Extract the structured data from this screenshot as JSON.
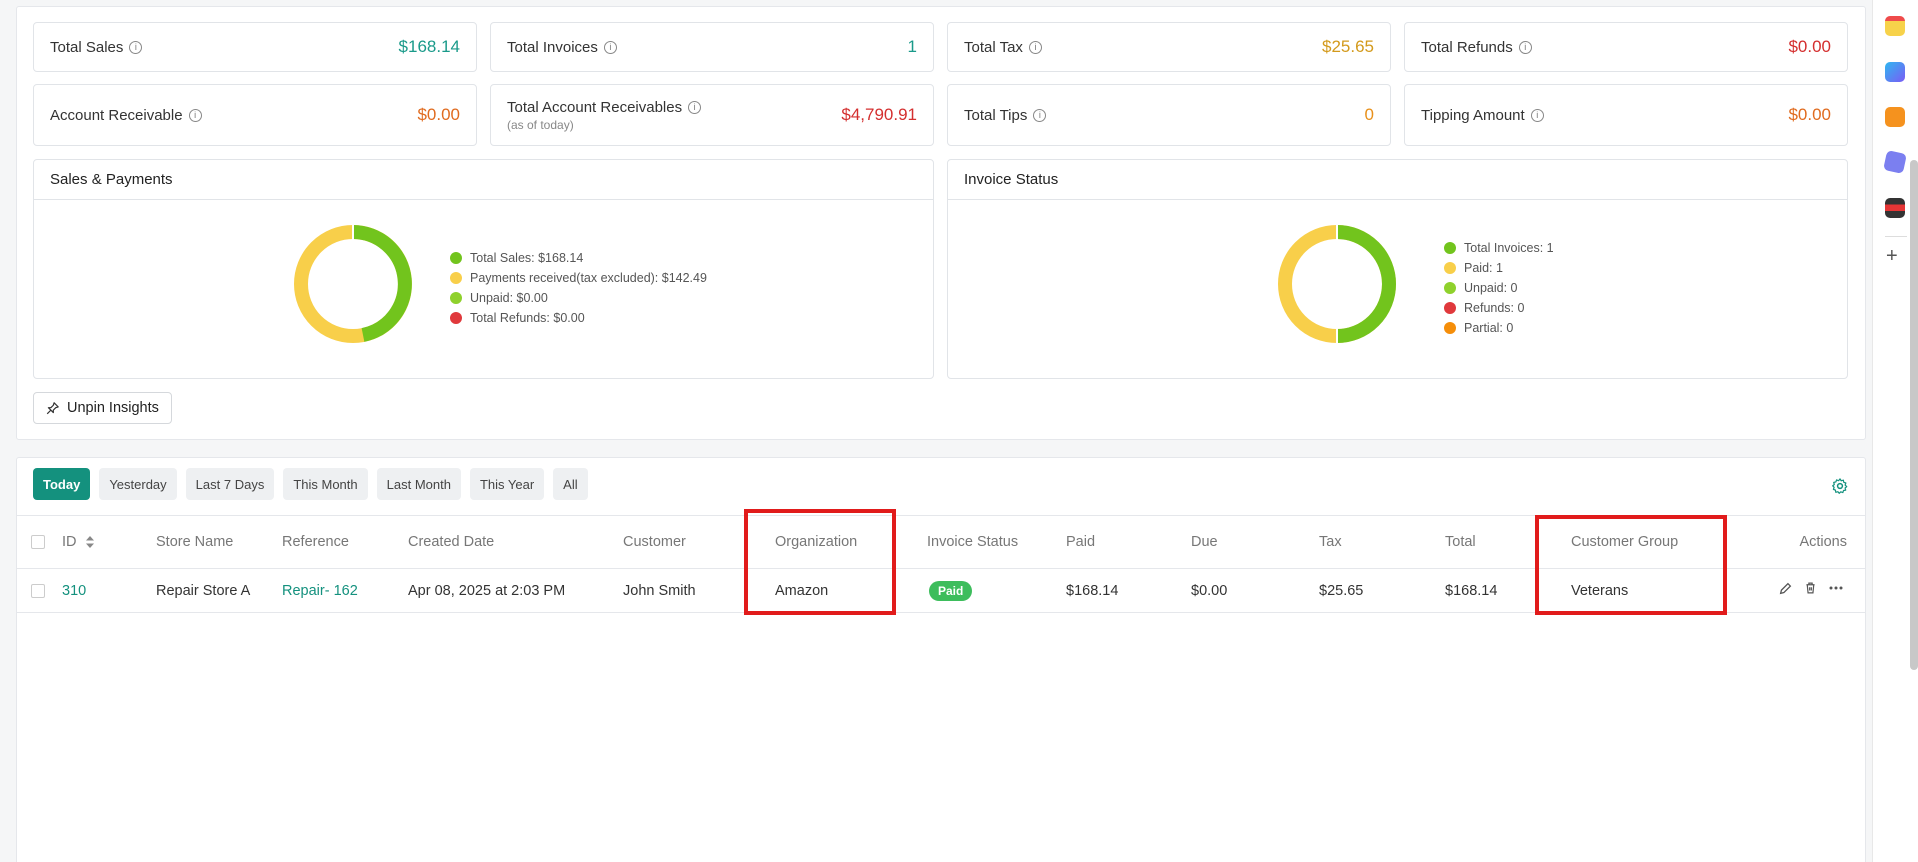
{
  "stats": [
    {
      "label": "Total Sales",
      "value": "$168.14",
      "color": "#1a9a8a"
    },
    {
      "label": "Total Invoices",
      "value": "1",
      "color": "#1a9a8a"
    },
    {
      "label": "Total Tax",
      "value": "$25.65",
      "color": "#d39a1c"
    },
    {
      "label": "Total Refunds",
      "value": "$0.00",
      "color": "#d42f2f"
    },
    {
      "label": "Account Receivable",
      "value": "$0.00",
      "color": "#e06b1f"
    },
    {
      "label": "Total Account Receivables",
      "sublabel": "(as of today)",
      "value": "$4,790.91",
      "color": "#d42f2f"
    },
    {
      "label": "Total Tips",
      "value": "0",
      "color": "#e8901a"
    },
    {
      "label": "Tipping Amount",
      "value": "$0.00",
      "color": "#e06b1f"
    }
  ],
  "sales_card": {
    "title": "Sales & Payments",
    "legend": [
      {
        "label": "Total Sales: $168.14",
        "color": "#72c41d"
      },
      {
        "label": "Payments received(tax excluded): $142.49",
        "color": "#f8cf4a"
      },
      {
        "label": "Unpaid: $0.00",
        "color": "#8fd12c"
      },
      {
        "label": "Total Refunds: $0.00",
        "color": "#e0393c"
      }
    ]
  },
  "invoice_card": {
    "title": "Invoice Status",
    "legend": [
      {
        "label": "Total Invoices: 1",
        "color": "#72c41d"
      },
      {
        "label": "Paid: 1",
        "color": "#f8cf4a"
      },
      {
        "label": "Unpaid: 0",
        "color": "#8fd12c"
      },
      {
        "label": "Refunds: 0",
        "color": "#e0393c"
      },
      {
        "label": "Partial: 0",
        "color": "#f58e0a"
      }
    ]
  },
  "unpin_label": "Unpin Insights",
  "filters": [
    "Today",
    "Yesterday",
    "Last 7 Days",
    "This Month",
    "Last Month",
    "This Year",
    "All"
  ],
  "columns": {
    "id": "ID",
    "store": "Store Name",
    "reference": "Reference",
    "created": "Created Date",
    "customer": "Customer",
    "organization": "Organization",
    "status": "Invoice Status",
    "paid": "Paid",
    "due": "Due",
    "tax": "Tax",
    "total": "Total",
    "group": "Customer Group",
    "actions": "Actions"
  },
  "row": {
    "id": "310",
    "store": "Repair Store A",
    "reference": "Repair- 162",
    "created": "Apr 08, 2025 at 2:03 PM",
    "customer": "John Smith",
    "organization": "Amazon",
    "status": "Paid",
    "paid": "$168.14",
    "due": "$0.00",
    "tax": "$25.65",
    "total": "$168.14",
    "group": "Veterans"
  },
  "colors": {
    "accent": "#14917e",
    "highlight": "#e11b1b",
    "donut_green": "#72c41d",
    "donut_yellow": "#f8cf4a"
  }
}
